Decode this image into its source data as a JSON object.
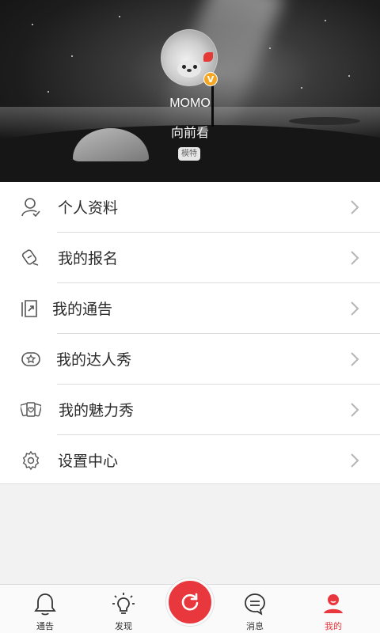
{
  "profile": {
    "username": "MOMO",
    "signature": "向前看",
    "verified_badge": "V",
    "tag_label": "模特"
  },
  "menu": {
    "items": [
      {
        "label": "个人资料",
        "icon": "user-icon"
      },
      {
        "label": "我的报名",
        "icon": "signup-icon"
      },
      {
        "label": "我的通告",
        "icon": "notice-doc-icon"
      },
      {
        "label": "我的达人秀",
        "icon": "video-star-icon"
      },
      {
        "label": "我的魅力秀",
        "icon": "cards-heart-icon"
      },
      {
        "label": "设置中心",
        "icon": "gear-icon"
      }
    ]
  },
  "tabbar": {
    "tabs": [
      {
        "label": "通告",
        "icon": "bell-icon"
      },
      {
        "label": "发现",
        "icon": "lightbulb-icon"
      },
      {
        "label": "",
        "icon": "refresh-icon"
      },
      {
        "label": "消息",
        "icon": "message-icon"
      },
      {
        "label": "我的",
        "icon": "person-icon"
      }
    ],
    "active_tab": "我的"
  },
  "colors": {
    "accent": "#e8383d",
    "badge": "#f5a623"
  }
}
